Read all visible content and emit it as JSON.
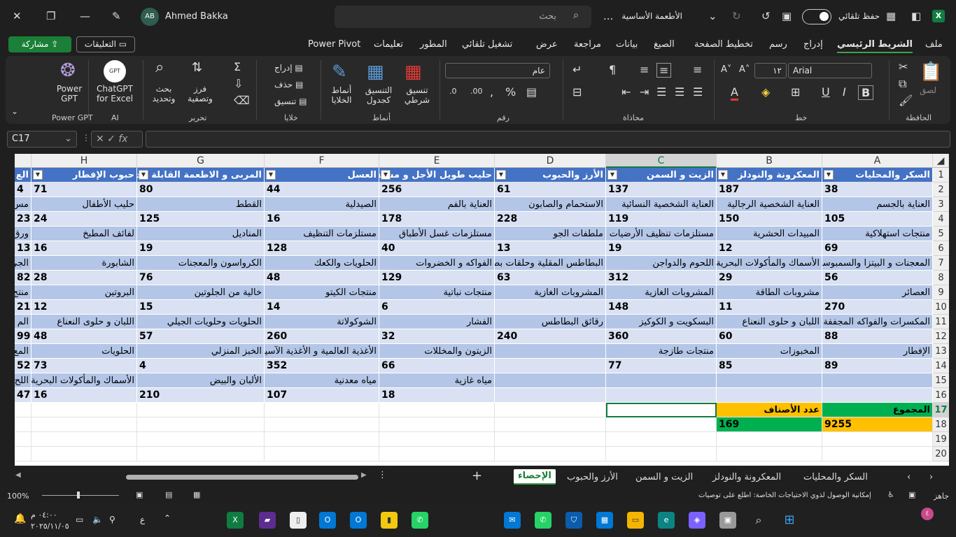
{
  "window": {
    "title": "الأطعمة الأساسية",
    "title_ellipsis": "...",
    "user_name": "Ahmed Bakka",
    "user_initials": "AB",
    "search_placeholder": "بحث",
    "autosave_label": "حفظ تلقائي",
    "autosave_on": true
  },
  "menu": {
    "items": [
      "ملف",
      "الشريط الرئيسي",
      "إدراج",
      "رسم",
      "تخطيط الصفحة",
      "الصيغ",
      "بيانات",
      "مراجعة",
      "عرض",
      "تشغيل تلقائي",
      "المطور",
      "تعليمات",
      "Power Pivot"
    ],
    "active": "الشريط الرئيسي",
    "share_label": "مشاركة",
    "comments_label": "التعليقات"
  },
  "ribbon": {
    "groups": {
      "clipboard": "الحافظة",
      "font": "خط",
      "alignment": "محاذاة",
      "number": "رقم",
      "styles": "أنماط",
      "cells": "خلايا",
      "editing": "تحرير",
      "ai": "AI",
      "power_gpt": "Power GPT"
    },
    "paste_label": "لصق",
    "font_name": "Arial",
    "font_size": "١٢",
    "number_format": "عام",
    "conditional_formatting": "تنسيق شرطي",
    "format_as_table": "التنسيق كجدول",
    "cell_styles": "أنماط الخلايا",
    "insert": "إدراج",
    "delete": "حذف",
    "format": "تنسيق",
    "sort_filter": "فرز وتصفية",
    "find_select": "بحث وتحديد",
    "chatgpt": "ChatGPT for Excel",
    "power_gpt_btn": "Power GPT"
  },
  "formula_bar": {
    "name_box": "C17",
    "fx": "fx",
    "formula": ""
  },
  "sheet": {
    "columns": [
      "A",
      "B",
      "C",
      "D",
      "E",
      "F",
      "G",
      "H"
    ],
    "selected_column": "C",
    "selected_row": 17,
    "row_numbers": [
      "1",
      "2",
      "3",
      "4",
      "5",
      "6",
      "7",
      "8",
      "9",
      "10",
      "11",
      "12",
      "13",
      "14",
      "15",
      "16",
      "17",
      "18",
      "19",
      "20"
    ],
    "headers": [
      "السكر والمحليات",
      "المعكرونة والنودلز",
      "الزيت و السمن",
      "الأرز والحبوب",
      "حليب طويل الأجل و مشتقاته",
      "العسل",
      "المربى و الاطعمة القابلة للدهن",
      "حبوب الإفطار"
    ],
    "partial_header": "الع",
    "rows": [
      [
        "38",
        "187",
        "137",
        "61",
        "256",
        "44",
        "80",
        "71"
      ],
      [
        "العناية بالجسم",
        "العناية الشخصية الرجالية",
        "العناية الشخصية النسائية",
        "الاستحمام والصابون",
        "العناية بالفم",
        "الصيدلية",
        "القطط",
        "حليب الأطفال"
      ],
      [
        "105",
        "150",
        "119",
        "228",
        "178",
        "16",
        "125",
        "24"
      ],
      [
        "منتجات استهلاكية",
        "المبيدات الحشرية",
        "مستلزمات تنظيف الأرضيات",
        "ملطفات الجو",
        "مستلزمات غسل الأطباق",
        "مستلزمات التنظيف",
        "المناديل",
        "لفائف المطبخ"
      ],
      [
        "69",
        "12",
        "19",
        "13",
        "40",
        "128",
        "19",
        "16"
      ],
      [
        "المعجنات و البيتزا والسمبوسة",
        "الأسماك والمأكولات البحرية",
        "اللحوم والدواجن",
        "البطاطس المقلية وحلقات بصل",
        "الفواكه و الخضروات",
        "الحلويات والكعك",
        "الكرواسون والمعجنات",
        "الشابورة"
      ],
      [
        "56",
        "29",
        "312",
        "63",
        "129",
        "48",
        "76",
        "28"
      ],
      [
        "العصائر",
        "مشروبات الطاقة",
        "المشروبات الغازية",
        "المشروبات الغازية",
        "منتجات نباتية",
        "منتجات الكيتو",
        "خالية من الجلوتين",
        "البروتين"
      ],
      [
        "270",
        "11",
        "148",
        "",
        "6",
        "14",
        "15",
        "12"
      ],
      [
        "المكسرات والفواكه المجففة",
        "اللبان و حلوى النعناع",
        "البسكويت و الكوكيز",
        "رقائق البطاطس",
        "الفشار",
        "الشوكولاتة",
        "الحلويات وحلويات الجيلي",
        "اللبان و حلوى النعناع"
      ],
      [
        "88",
        "60",
        "360",
        "240",
        "32",
        "260",
        "57",
        "48"
      ],
      [
        "الإفطار",
        "المخبوزات",
        "منتجات طازجة",
        "",
        "الزيتون والمخللات",
        "الأغذية العالمية و الأغذية الآسيوية",
        "الخبز المنزلي",
        "الحلويات"
      ],
      [
        "89",
        "85",
        "77",
        "",
        "66",
        "352",
        "4",
        "73"
      ],
      [
        "",
        "",
        "",
        "",
        "مياه غازية",
        "مياه معدنية",
        "الألبان والبيض",
        "الأسماك والمأكولات البحرية"
      ],
      [
        "",
        "",
        "",
        "",
        "18",
        "107",
        "210",
        "16"
      ]
    ],
    "partial_col": [
      "4",
      "مس",
      "23",
      "ورق",
      "13",
      "الجي",
      "82",
      "منتج",
      "21",
      "الم",
      "99",
      "المع",
      "52",
      "اللح",
      "47"
    ],
    "summary": {
      "total_label": "المجموع",
      "total_value": "9255",
      "count_label": "عدد الأصناف",
      "count_value": "169"
    }
  },
  "sheet_tabs": {
    "tabs": [
      "السكر والمحليات",
      "المعكرونة والنودلز",
      "الزيت و السمن",
      "الأرز والحبوب",
      "الإحصاء"
    ],
    "active": "الإحصاء"
  },
  "status": {
    "ready": "جاهز",
    "accessibility": "إمكانية الوصول لذوي الاحتياجات الخاصة: اطلع على توصيات",
    "zoom": "100%"
  },
  "taskbar": {
    "time": "٠٤:٠٠ م",
    "date": "٢٠٢٥/١١/٠٥",
    "lang": "ع",
    "notif_badge": "٤"
  },
  "colors": {
    "header_blue": "#4472c4",
    "band_dark": "#b4c6e7",
    "band_light": "#d9e1f2",
    "yellow": "#ffc000",
    "green": "#00b050",
    "accent": "#107c41"
  }
}
